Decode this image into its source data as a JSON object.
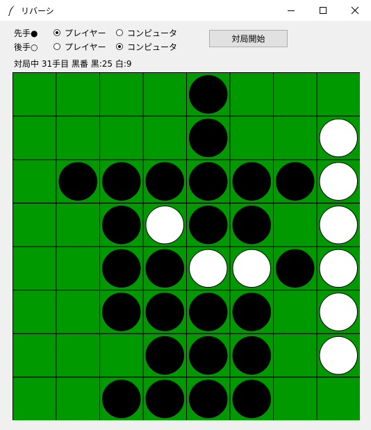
{
  "window": {
    "title": "リバーシ",
    "icon": "feather-icon",
    "minimize_icon": "minimize-icon",
    "maximize_icon": "maximize-icon",
    "close_icon": "close-icon"
  },
  "controls": {
    "first_label": "先手●",
    "second_label": "後手○",
    "player_label": "プレイヤー",
    "computer_label": "コンピュータ",
    "first_player_selected": "player",
    "second_player_selected": "computer",
    "start_button": "対局開始"
  },
  "status": {
    "text": "対局中 31手目 黒番 黒:25 白:9"
  },
  "board": {
    "size": 8,
    "board_color": "#009900",
    "line_color": "#000000",
    "black_color": "#000000",
    "white_color": "#ffffff",
    "cells": [
      "....B...",
      "....B..W",
      ".BBBBBBW",
      "..BWBB.W",
      "..BBWWBW",
      "..BBBB.W",
      "...BBB.W",
      "..BBBB.."
    ]
  }
}
